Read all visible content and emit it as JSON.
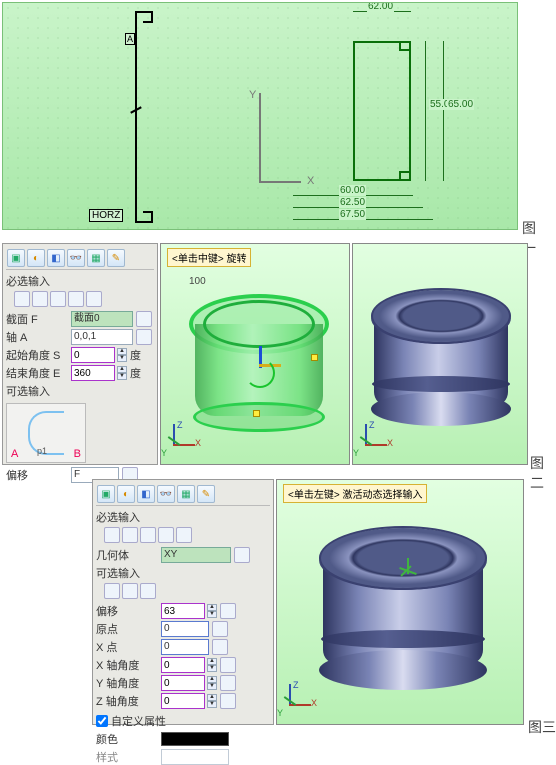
{
  "fig1": {
    "caption": "图一",
    "axis_x": "X",
    "axis_y": "Y",
    "ann_hd": "HORZ",
    "ann_a": "A",
    "dims": {
      "top": "62.00",
      "right1": "55.00",
      "right2": "65.00",
      "bot1": "60.00",
      "bot2": "62.50",
      "bot3": "67.50"
    }
  },
  "fig2": {
    "caption": "图二",
    "tip": "<单击中键> 旋转",
    "panel": {
      "sect1": "必选输入",
      "row_section": "截面 F",
      "row_section_val": "截面0",
      "row_axis": "轴 A",
      "row_axis_val": "0,0,1",
      "row_start": "起始角度 S",
      "row_start_val": "0",
      "row_end": "结束角度 E",
      "row_end_val": "360",
      "sect2": "可选输入",
      "preview_A": "A",
      "preview_B": "B",
      "preview_p1": "p1",
      "row_offset": "偏移",
      "row_offset_val": "F",
      "deg_label": "度",
      "val_100": "100"
    }
  },
  "fig3": {
    "caption": "图三",
    "tip": "<单击左键> 激活动态选择输入",
    "panel": {
      "sect1": "必选输入",
      "row_geom": "几何体",
      "row_geom_val": "XY",
      "sect2": "可选输入",
      "row_offset": "偏移",
      "row_offset_val": "63",
      "row_origin": "原点",
      "row_origin_val": "0",
      "row_xpt": "X 点",
      "row_xpt_val": "0",
      "row_xang": "X 轴角度",
      "row_xang_val": "0",
      "row_yang": "Y 轴角度",
      "row_yang_val": "0",
      "row_zang": "Z 轴角度",
      "row_zang_val": "0",
      "chk_custom": "自定义属性",
      "row_color": "颜色",
      "row_style": "样式"
    }
  },
  "triad": {
    "x": "X",
    "y": "Y",
    "z": "Z"
  }
}
